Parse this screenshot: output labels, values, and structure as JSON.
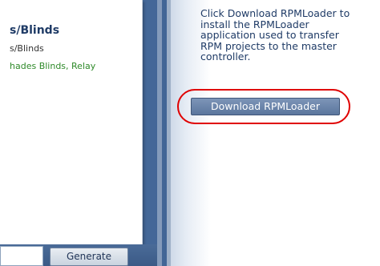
{
  "left_panel": {
    "title": "s/Blinds",
    "subtitle": "s/Blinds",
    "tags": "hades Blinds, Relay"
  },
  "bottom_bar": {
    "generate_label": "Generate"
  },
  "right_panel": {
    "instructions": "Click Download RPMLoader to install the RPMLoader application used to transfer RPM projects to the master controller.",
    "download_label": "Download RPMLoader"
  }
}
